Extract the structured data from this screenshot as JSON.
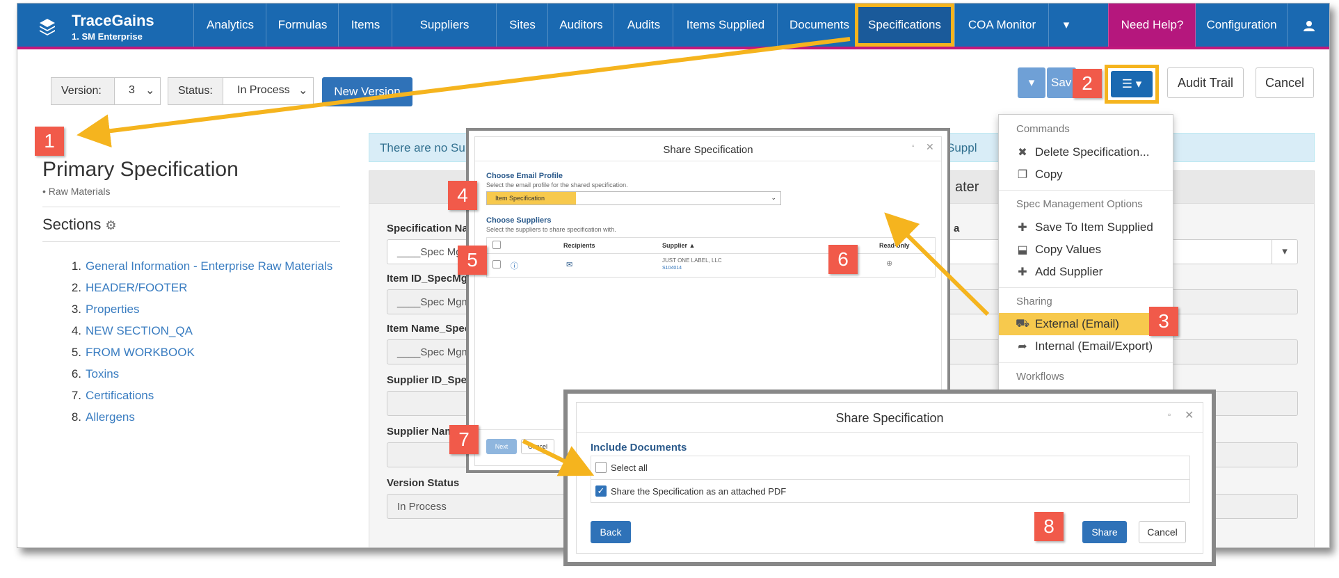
{
  "brand": {
    "name": "TraceGains",
    "sub": "1. SM Enterprise"
  },
  "nav": {
    "items": [
      "Analytics",
      "Formulas",
      "Items",
      "Suppliers",
      "Sites",
      "Auditors",
      "Audits",
      "Items Supplied",
      "Documents",
      "Specifications",
      "COA Monitor"
    ],
    "help": "Need Help?",
    "config": "Configuration"
  },
  "toolbar": {
    "version_label": "Version:",
    "version_value": "3",
    "status_label": "Status:",
    "status_value": "In Process",
    "new_version": "New Version",
    "save": "Sav",
    "audit_trail": "Audit Trail",
    "cancel": "Cancel"
  },
  "spec": {
    "title": "Primary Specification",
    "subtitle": "• Raw Materials",
    "sections_title": "Sections",
    "sections": [
      "General Information - Enterprise Raw Materials",
      "HEADER/FOOTER",
      "Properties",
      "NEW SECTION_QA",
      "FROM WORKBOOK",
      "Toxins",
      "Certifications",
      "Allergens"
    ]
  },
  "alert": {
    "left": "There are no Sup",
    "right": "Suppl"
  },
  "panel": {
    "header_text": "ater"
  },
  "fields": [
    {
      "label": "Specification Nam",
      "value": "____Spec Mgm"
    },
    {
      "label": "Item ID_SpecMg",
      "value": "____Spec Mgmt"
    },
    {
      "label": "Item Name_Spec",
      "value": "____Spec Mgmt"
    },
    {
      "label": "Supplier ID_Spec",
      "value": ""
    },
    {
      "label": "Supplier Nam",
      "value": ""
    },
    {
      "label": "Version Status",
      "value": "In Process"
    }
  ],
  "right_field_label": "a",
  "dropdown": {
    "commands_header": "Commands",
    "delete": "Delete Specification...",
    "copy": "Copy",
    "spec_header": "Spec Management Options",
    "save_item": "Save To Item Supplied",
    "copy_values": "Copy Values",
    "add_supplier": "Add Supplier",
    "sharing_header": "Sharing",
    "external": "External (Email)",
    "internal": "Internal (Email/Export)",
    "workflows_header": "Workflows"
  },
  "dialog1": {
    "title": "Share Specification",
    "email_title": "Choose Email Profile",
    "email_desc": "Select the email profile for the shared specification.",
    "email_value": "Item Specification",
    "suppliers_title": "Choose Suppliers",
    "suppliers_desc": "Select the suppliers to share specification with.",
    "col_recipients": "Recipients",
    "col_supplier": "Supplier ▲",
    "col_readonly": "Read-only",
    "row_supplier": "JUST ONE LABEL, LLC",
    "row_id": "S104014",
    "next": "Next",
    "cancel": "Cancel"
  },
  "dialog2": {
    "title": "Share Specification",
    "include_docs": "Include Documents",
    "select_all": "Select all",
    "attach_pdf": "Share the Specification as an attached PDF",
    "back": "Back",
    "share": "Share",
    "cancel": "Cancel"
  },
  "callouts": [
    "1",
    "2",
    "3",
    "4",
    "5",
    "6",
    "7",
    "8"
  ],
  "colors": {
    "nav": "#1a69b1",
    "help": "#b5177d",
    "highlight": "#f5b41e",
    "badge": "#f15a4a",
    "link": "#3a7dc1"
  }
}
